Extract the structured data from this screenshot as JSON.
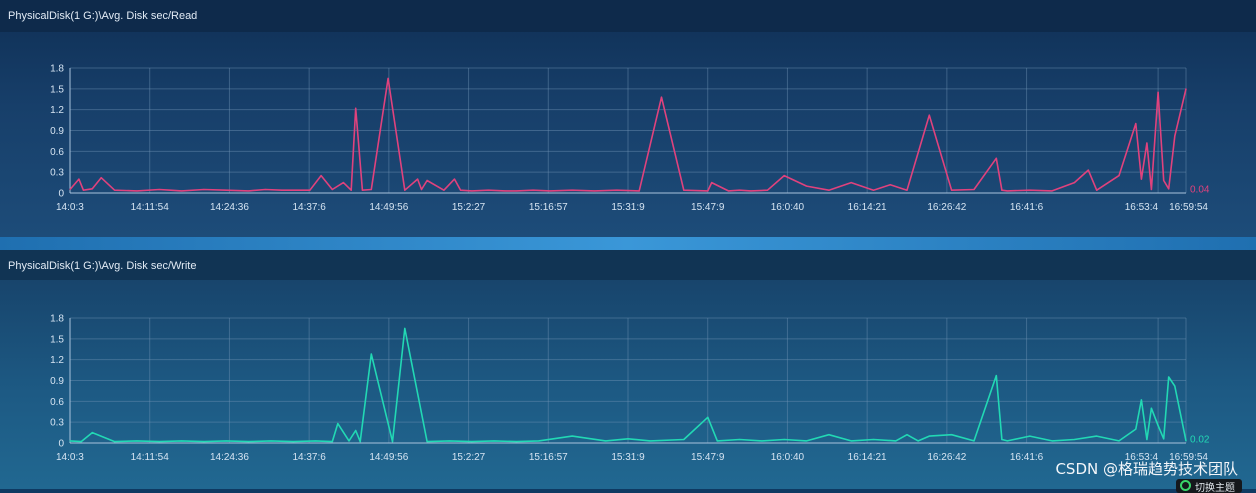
{
  "panels": {
    "read": {
      "title": "PhysicalDisk(1 G:)\\Avg. Disk sec/Read"
    },
    "write": {
      "title": "PhysicalDisk(1 G:)\\Avg. Disk sec/Write"
    }
  },
  "watermark": "CSDN @格瑞趋势技术团队",
  "theme_button": {
    "label": "切换主题"
  },
  "chart_data": [
    {
      "type": "line",
      "title": "PhysicalDisk(1 G:)\\Avg. Disk sec/Read",
      "color": "#e0427d",
      "grid": true,
      "ylim": [
        0,
        1.8
      ],
      "yticks": [
        "0",
        "0.3",
        "0.6",
        "0.9",
        "1.2",
        "1.5",
        "1.8"
      ],
      "xticks": [
        "14:0:3",
        "14:11:54",
        "14:24:36",
        "14:37:6",
        "14:49:56",
        "15:2:27",
        "15:16:57",
        "15:31:9",
        "15:47:9",
        "16:0:40",
        "16:14:21",
        "16:26:42",
        "16:41:6",
        "16:53:4",
        "16:59:54"
      ],
      "last_value_label": "0.04",
      "x": [
        0,
        0.008,
        0.012,
        0.02,
        0.028,
        0.04,
        0.06,
        0.08,
        0.09,
        0.1,
        0.12,
        0.14,
        0.16,
        0.175,
        0.19,
        0.2,
        0.215,
        0.225,
        0.235,
        0.245,
        0.252,
        0.256,
        0.262,
        0.27,
        0.285,
        0.3,
        0.3115,
        0.315,
        0.32,
        0.335,
        0.3445,
        0.35,
        0.36,
        0.375,
        0.39,
        0.4,
        0.415,
        0.43,
        0.45,
        0.47,
        0.49,
        0.51,
        0.53,
        0.55,
        0.5715,
        0.575,
        0.59,
        0.6,
        0.61,
        0.625,
        0.64,
        0.66,
        0.68,
        0.7,
        0.72,
        0.735,
        0.75,
        0.77,
        0.79,
        0.81,
        0.83,
        0.835,
        0.84,
        0.86,
        0.88,
        0.9,
        0.9125,
        0.92,
        0.94,
        0.955,
        0.96,
        0.965,
        0.969,
        0.975,
        0.98,
        0.9845,
        0.99,
        1
      ],
      "y": [
        0.05,
        0.2,
        0.04,
        0.06,
        0.22,
        0.04,
        0.03,
        0.05,
        0.04,
        0.03,
        0.05,
        0.04,
        0.03,
        0.05,
        0.04,
        0.04,
        0.04,
        0.25,
        0.05,
        0.15,
        0.04,
        1.22,
        0.04,
        0.05,
        1.65,
        0.04,
        0.2,
        0.05,
        0.18,
        0.04,
        0.2,
        0.04,
        0.03,
        0.04,
        0.03,
        0.03,
        0.04,
        0.03,
        0.04,
        0.03,
        0.04,
        0.03,
        1.38,
        0.04,
        0.03,
        0.15,
        0.03,
        0.04,
        0.03,
        0.04,
        0.25,
        0.1,
        0.04,
        0.15,
        0.04,
        0.12,
        0.04,
        1.12,
        0.04,
        0.05,
        0.5,
        0.04,
        0.03,
        0.04,
        0.03,
        0.15,
        0.33,
        0.04,
        0.25,
        1.0,
        0.2,
        0.72,
        0.05,
        1.45,
        0.18,
        0.06,
        0.82,
        1.5
      ]
    },
    {
      "type": "line",
      "title": "PhysicalDisk(1 G:)\\Avg. Disk sec/Write",
      "color": "#22d8b4",
      "grid": true,
      "ylim": [
        0,
        1.8
      ],
      "yticks": [
        "0",
        "0.3",
        "0.6",
        "0.9",
        "1.2",
        "1.5",
        "1.8"
      ],
      "xticks": [
        "14:0:3",
        "14:11:54",
        "14:24:36",
        "14:37:6",
        "14:49:56",
        "15:2:27",
        "15:16:57",
        "15:31:9",
        "15:47:9",
        "16:0:40",
        "16:14:21",
        "16:26:42",
        "16:41:6",
        "16:53:4",
        "16:59:54"
      ],
      "last_value_label": "0.02",
      "x": [
        0,
        0.01,
        0.02,
        0.04,
        0.06,
        0.08,
        0.1,
        0.12,
        0.14,
        0.16,
        0.18,
        0.2,
        0.22,
        0.235,
        0.24,
        0.25,
        0.256,
        0.26,
        0.27,
        0.289,
        0.3,
        0.32,
        0.34,
        0.36,
        0.38,
        0.4,
        0.42,
        0.45,
        0.48,
        0.5,
        0.52,
        0.55,
        0.5715,
        0.58,
        0.6,
        0.62,
        0.64,
        0.66,
        0.68,
        0.7,
        0.72,
        0.74,
        0.75,
        0.76,
        0.77,
        0.79,
        0.81,
        0.83,
        0.835,
        0.84,
        0.86,
        0.88,
        0.9,
        0.92,
        0.94,
        0.955,
        0.96,
        0.965,
        0.969,
        0.975,
        0.98,
        0.9845,
        0.99,
        1
      ],
      "y": [
        0.03,
        0.02,
        0.15,
        0.02,
        0.03,
        0.02,
        0.03,
        0.02,
        0.03,
        0.02,
        0.03,
        0.02,
        0.03,
        0.02,
        0.28,
        0.03,
        0.18,
        0.02,
        1.28,
        0.02,
        1.65,
        0.02,
        0.03,
        0.02,
        0.03,
        0.02,
        0.03,
        0.1,
        0.03,
        0.06,
        0.03,
        0.05,
        0.37,
        0.03,
        0.05,
        0.03,
        0.05,
        0.03,
        0.12,
        0.03,
        0.05,
        0.03,
        0.12,
        0.03,
        0.1,
        0.12,
        0.03,
        0.97,
        0.05,
        0.03,
        0.1,
        0.03,
        0.05,
        0.1,
        0.03,
        0.2,
        0.62,
        0.05,
        0.5,
        0.25,
        0.06,
        0.95,
        0.82,
        0.03
      ]
    }
  ]
}
